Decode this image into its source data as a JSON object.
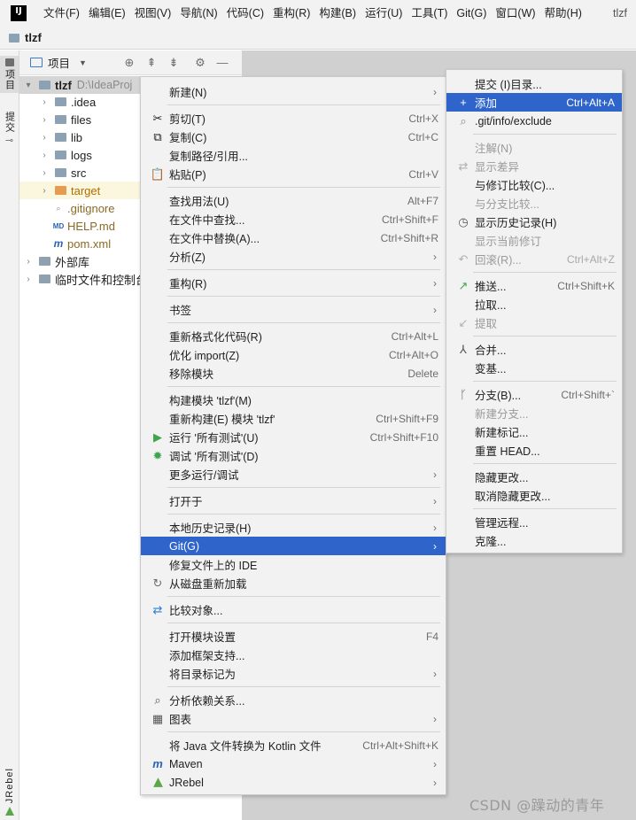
{
  "menubar": {
    "logo": "IJ",
    "items": [
      "文件(F)",
      "编辑(E)",
      "视图(V)",
      "导航(N)",
      "代码(C)",
      "重构(R)",
      "构建(B)",
      "运行(U)",
      "工具(T)",
      "Git(G)",
      "窗口(W)",
      "帮助(H)"
    ],
    "window_title": "tlzf"
  },
  "navbar": {
    "project": "tlzf"
  },
  "left_stripe": {
    "project": "项目",
    "commit": "提交",
    "jrebel": "JRebel"
  },
  "project_panel": {
    "view_label": "项目",
    "tree": [
      {
        "name": "tlzf",
        "path": "D:\\IdeaProj",
        "arrow": "▾"
      },
      {
        "name": ".idea",
        "arrow": "›"
      },
      {
        "name": "files",
        "arrow": "›"
      },
      {
        "name": "lib",
        "arrow": "›"
      },
      {
        "name": "logs",
        "arrow": "›"
      },
      {
        "name": "src",
        "arrow": "›"
      },
      {
        "name": "target",
        "arrow": "›"
      },
      {
        "name": ".gitignore"
      },
      {
        "name": "HELP.md"
      },
      {
        "name": "pom.xml"
      },
      {
        "name": "外部库",
        "arrow": "›"
      },
      {
        "name": "临时文件和控制台",
        "arrow": "›"
      }
    ]
  },
  "context_menu": {
    "items": [
      {
        "label": "新建(N)"
      },
      {
        "label": "剪切(T)",
        "shortcut": "Ctrl+X"
      },
      {
        "label": "复制(C)",
        "shortcut": "Ctrl+C"
      },
      {
        "label": "复制路径/引用..."
      },
      {
        "label": "粘贴(P)",
        "shortcut": "Ctrl+V"
      },
      {
        "label": "查找用法(U)",
        "shortcut": "Alt+F7"
      },
      {
        "label": "在文件中查找...",
        "shortcut": "Ctrl+Shift+F"
      },
      {
        "label": "在文件中替换(A)...",
        "shortcut": "Ctrl+Shift+R"
      },
      {
        "label": "分析(Z)"
      },
      {
        "label": "重构(R)"
      },
      {
        "label": "书签"
      },
      {
        "label": "重新格式化代码(R)",
        "shortcut": "Ctrl+Alt+L"
      },
      {
        "label": "优化 import(Z)",
        "shortcut": "Ctrl+Alt+O"
      },
      {
        "label": "移除模块",
        "shortcut": "Delete"
      },
      {
        "label": "构建模块 'tlzf'(M)"
      },
      {
        "label": "重新构建(E) 模块 'tlzf'",
        "shortcut": "Ctrl+Shift+F9"
      },
      {
        "label": "运行 '所有测试'(U)",
        "shortcut": "Ctrl+Shift+F10"
      },
      {
        "label": "调试 '所有测试'(D)"
      },
      {
        "label": "更多运行/调试"
      },
      {
        "label": "打开于"
      },
      {
        "label": "本地历史记录(H)"
      },
      {
        "label": "Git(G)"
      },
      {
        "label": "修复文件上的 IDE"
      },
      {
        "label": "从磁盘重新加载"
      },
      {
        "label": "比较对象..."
      },
      {
        "label": "打开模块设置",
        "shortcut": "F4"
      },
      {
        "label": "添加框架支持..."
      },
      {
        "label": "将目录标记为"
      },
      {
        "label": "分析依赖关系..."
      },
      {
        "label": "图表"
      },
      {
        "label": "将 Java 文件转换为 Kotlin 文件",
        "shortcut": "Ctrl+Alt+Shift+K"
      },
      {
        "label": "Maven"
      },
      {
        "label": "JRebel"
      }
    ]
  },
  "git_submenu": {
    "items": [
      {
        "label": "提交 (I)目录..."
      },
      {
        "label": "添加",
        "shortcut": "Ctrl+Alt+A"
      },
      {
        "label": ".git/info/exclude"
      },
      {
        "label": "注解(N)"
      },
      {
        "label": "显示差异"
      },
      {
        "label": "与修订比较(C)..."
      },
      {
        "label": "与分支比较..."
      },
      {
        "label": "显示历史记录(H)"
      },
      {
        "label": "显示当前修订"
      },
      {
        "label": "回滚(R)...",
        "shortcut": "Ctrl+Alt+Z"
      },
      {
        "label": "推送...",
        "shortcut": "Ctrl+Shift+K"
      },
      {
        "label": "拉取..."
      },
      {
        "label": "提取"
      },
      {
        "label": "合并..."
      },
      {
        "label": "变基..."
      },
      {
        "label": "分支(B)...",
        "shortcut": "Ctrl+Shift+`"
      },
      {
        "label": "新建分支..."
      },
      {
        "label": "新建标记..."
      },
      {
        "label": "重置 HEAD..."
      },
      {
        "label": "隐藏更改..."
      },
      {
        "label": "取消隐藏更改..."
      },
      {
        "label": "管理远程..."
      },
      {
        "label": "克隆..."
      }
    ]
  },
  "watermark": "CSDN @躁动的青年"
}
